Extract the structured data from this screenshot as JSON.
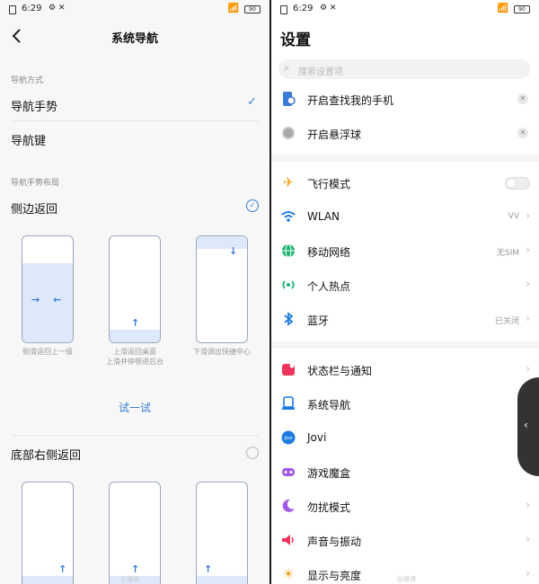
{
  "status_bar": {
    "time": "6:29",
    "tools": "⚙ ✕",
    "battery": "90"
  },
  "left": {
    "title": "系统导航",
    "section_mode": "导航方式",
    "opt_gesture": "导航手势",
    "opt_keys": "导航键",
    "section_layout": "导航手势布局",
    "layout_side": "侧边返回",
    "caption_1": "侧滑返回上一级",
    "caption_2": "上滑返回桌面\n上滑并停顿进后台",
    "caption_3": "下滑调出快捷中心",
    "try_label": "试一试",
    "layout_bottom": "底部右侧返回",
    "watermark": "@微博"
  },
  "right": {
    "title": "设置",
    "search_placeholder": "搜索设置项",
    "suggestions": [
      {
        "label": "开启查找我的手机",
        "icon": "find-phone-icon",
        "color": "#3a7bd5"
      },
      {
        "label": "开启悬浮球",
        "icon": "float-ball-icon",
        "color": "#aaaaaa"
      }
    ],
    "rows": [
      {
        "label": "飞行模式",
        "icon": "airplane-icon",
        "color": "#f5a623",
        "value": ""
      },
      {
        "label": "WLAN",
        "icon": "wifi-icon",
        "color": "#1e7be0",
        "value": "VV"
      },
      {
        "label": "移动网络",
        "icon": "globe-icon",
        "color": "#1cb46e",
        "value": "无SIM"
      },
      {
        "label": "个人热点",
        "icon": "hotspot-icon",
        "color": "#1cb46e",
        "value": ""
      },
      {
        "label": "蓝牙",
        "icon": "bluetooth-icon",
        "color": "#1e7be0",
        "value": "已关闭"
      },
      {
        "label": "状态栏与通知",
        "icon": "statusbar-icon",
        "color": "#f0355c",
        "value": ""
      },
      {
        "label": "系统导航",
        "icon": "navigation-icon",
        "color": "#1e7be0",
        "value": ""
      },
      {
        "label": "Jovi",
        "icon": "jovi-icon",
        "color": "#1e7be0",
        "value": ""
      },
      {
        "label": "游戏魔盒",
        "icon": "game-box-icon",
        "color": "#a259e6",
        "value": ""
      },
      {
        "label": "勿扰模式",
        "icon": "moon-icon",
        "color": "#a259e6",
        "value": ""
      },
      {
        "label": "声音与振动",
        "icon": "sound-icon",
        "color": "#f0355c",
        "value": ""
      },
      {
        "label": "显示与亮度",
        "icon": "brightness-icon",
        "color": "#f5a623",
        "value": ""
      }
    ],
    "watermark": "@微博"
  }
}
